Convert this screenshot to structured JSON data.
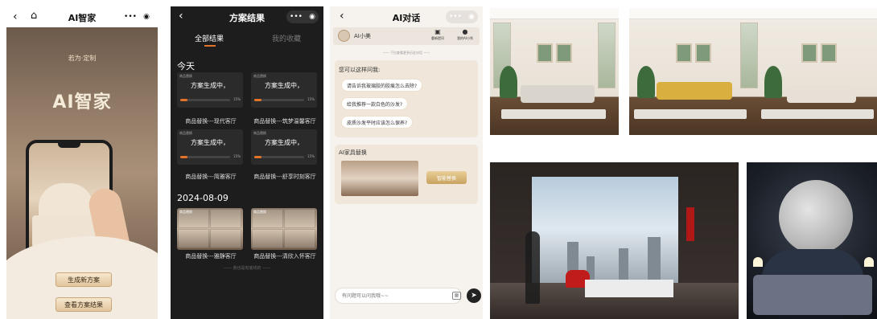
{
  "phone1": {
    "title": "AI智家",
    "brand": "若为·定制",
    "hero_title": "AI智家",
    "btn_new": "生成新方案",
    "btn_view": "查看方案结果"
  },
  "phone2": {
    "title": "方案结果",
    "tab_all": "全部结果",
    "tab_fav": "我的收藏",
    "day_today": "今天",
    "day_date": "2024-08-09",
    "cards": [
      {
        "tag": "商品替换",
        "msg": "方案生成中，",
        "progress": 0.15,
        "pct": "15%",
        "caption": "商品替换---现代客厅"
      },
      {
        "tag": "商品替换",
        "msg": "方案生成中，",
        "progress": 0.15,
        "pct": "15%",
        "caption": "商品替换---筑梦温馨客厅"
      },
      {
        "tag": "商品替换",
        "msg": "方案生成中，",
        "progress": 0.15,
        "pct": "15%",
        "caption": "商品替换---简雅客厅"
      },
      {
        "tag": "商品替换",
        "msg": "方案生成中，",
        "progress": 0.15,
        "pct": "15%",
        "caption": "商品替换---舒享时刻客厅"
      }
    ],
    "done": [
      {
        "tag": "商品替换",
        "caption": "商品替换---雅静客厅"
      },
      {
        "tag": "商品替换",
        "caption": "商品替换---清欣入怀客厅"
      }
    ],
    "end_text": "—— 我也是有底线的 ——"
  },
  "phone3": {
    "title": "AI对话",
    "agent_name": "AI小美",
    "act1": "重新提问",
    "act2": "我的AI小秀",
    "hint": "—— 下拉查看更多历史对话 ——",
    "ask_title": "您可以这样问我:",
    "questions": [
      "请告诉我玻璃胶的胶痕怎么去除?",
      "给我推荐一款白色的沙发?",
      "皮质沙发平时应该怎么保养?"
    ],
    "reply_title": "AI家具替换",
    "reply_btn": "智能替换",
    "input_placeholder": "有问题可以问我哦~~"
  },
  "icons": {
    "back": "chevron-left-icon",
    "home": "home-icon",
    "more": "more-icon",
    "target": "target-icon",
    "send": "send-icon",
    "image": "image-icon"
  },
  "colors": {
    "accent_orange": "#e2732a",
    "gold": "#c9a260",
    "dark_bg": "#1d1d1d"
  }
}
